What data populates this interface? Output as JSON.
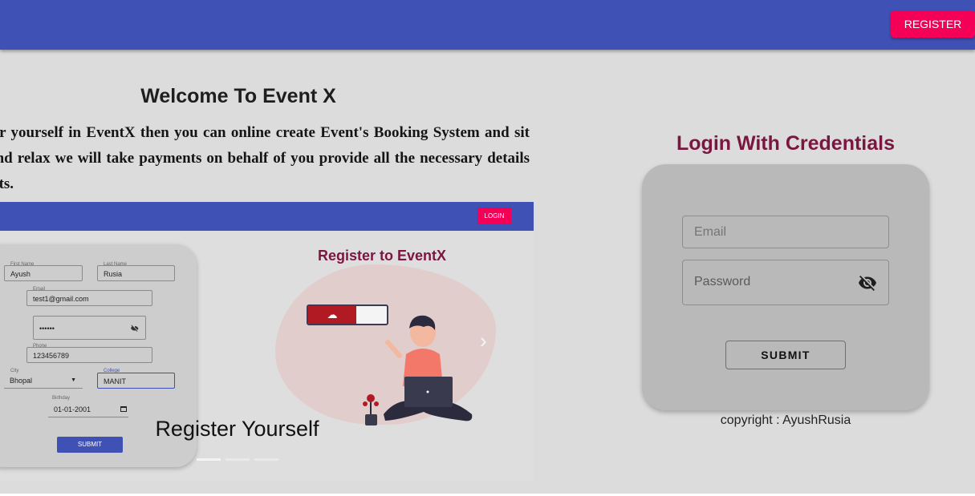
{
  "header": {
    "register_label": "REGISTER"
  },
  "intro": {
    "title": "Welcome To Event X",
    "paragraph": "Register yourself in EventX then you can online create Event's Booking System and sit back and relax we will take payments on behalf of you provide all the necessary details of clients."
  },
  "carousel": {
    "slide_login_label": "LOGIN",
    "form": {
      "first_name_label": "First Name",
      "first_name": "Ayush",
      "last_name_label": "Last Name",
      "last_name": "Rusia",
      "email_label": "Email",
      "email": "test1@gmail.com",
      "password_mask": "••••••",
      "phone_label": "Phone",
      "phone": "123456789",
      "city_label": "City",
      "city": "Bhopal",
      "college_label": "College",
      "college": "MANIT",
      "birthday_label": "Birthday",
      "birthday": "01-01-2001",
      "submit_label": "SUBMIT"
    },
    "slide_title": "Register to EventX",
    "caption": "Register Yourself",
    "indicator_count": 3,
    "active_index": 0
  },
  "login": {
    "title": "Login With Credentials",
    "email_placeholder": "Email",
    "password_placeholder": "Password",
    "submit_label": "SUBMIT",
    "copyright": "copyright : AyushRusia"
  },
  "colors": {
    "primary": "#3f51b5",
    "accent": "#f50057",
    "heading_maroon": "#7b1640",
    "background": "#dcdcdc"
  }
}
